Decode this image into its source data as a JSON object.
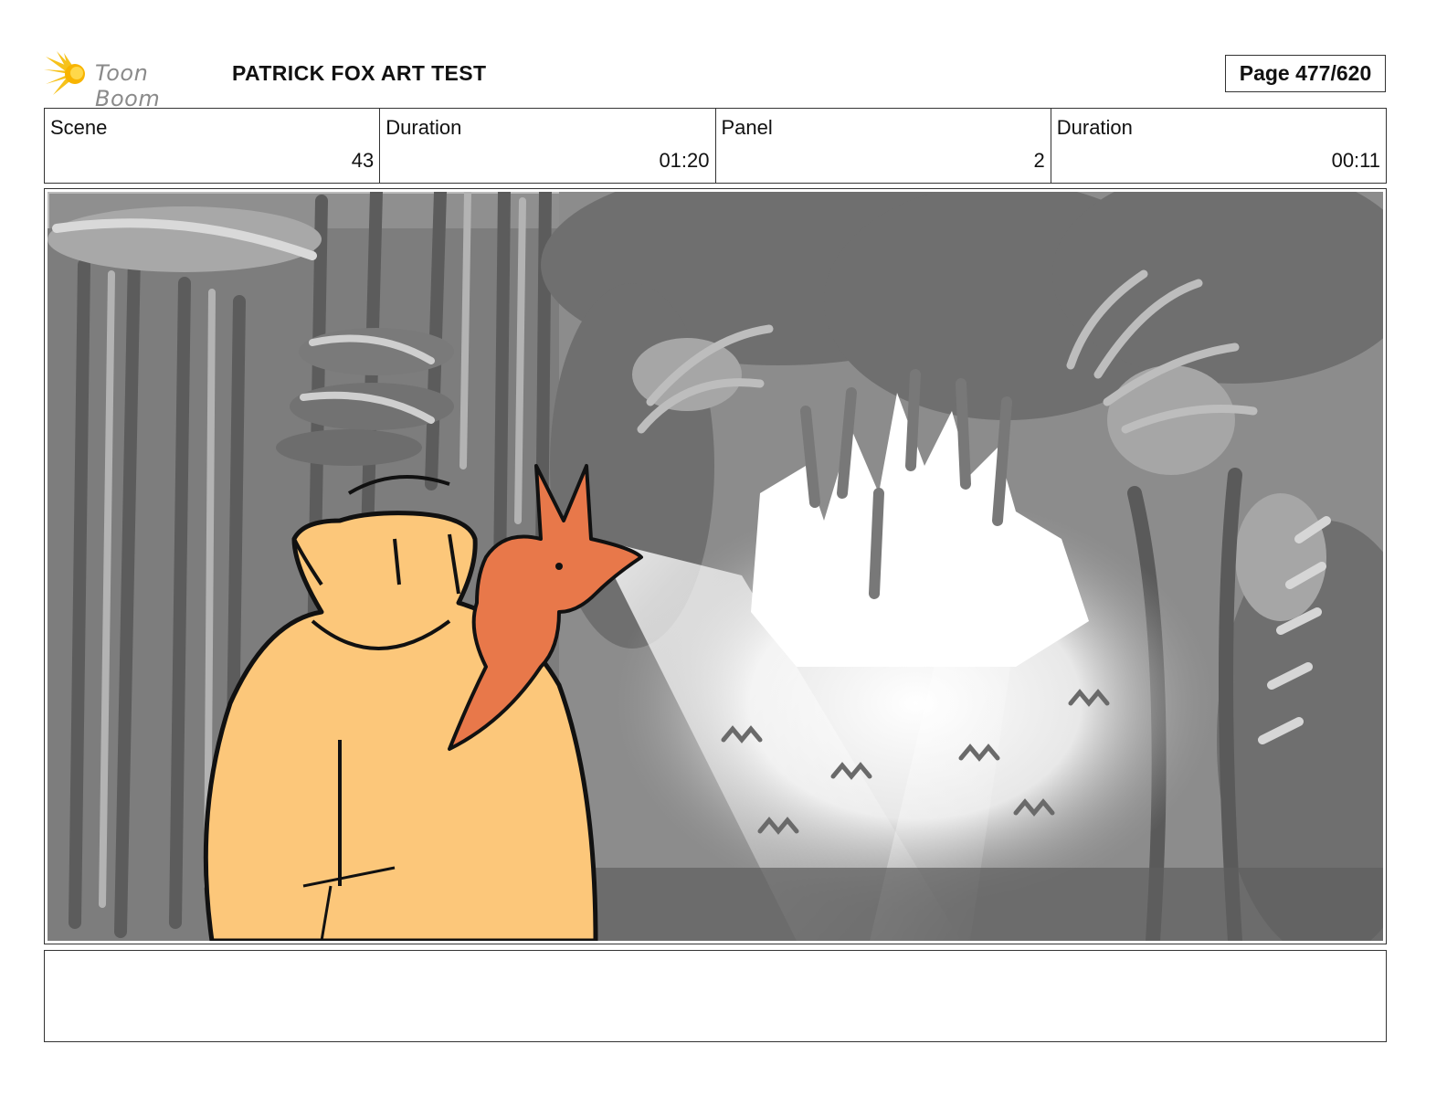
{
  "header": {
    "logo_text": "Toon Boom",
    "logo_icon": "starburst-logo-icon",
    "title": "PATRICK FOX ART TEST",
    "page": "Page 477/620"
  },
  "info": {
    "scene_label": "Scene",
    "scene_value": "43",
    "scene_duration_label": "Duration",
    "scene_duration_value": "01:20",
    "panel_label": "Panel",
    "panel_value": "2",
    "panel_duration_label": "Duration",
    "panel_duration_value": "00:11"
  },
  "panel": {
    "image": "storyboard-drawing",
    "colors": {
      "coat": "#fcc77a",
      "fox": "#e8784a",
      "light": "#ffffff",
      "dark_foliage": "#6e6e6e",
      "mid_foliage": "#9a9a9a"
    }
  },
  "notes": {
    "text": ""
  }
}
